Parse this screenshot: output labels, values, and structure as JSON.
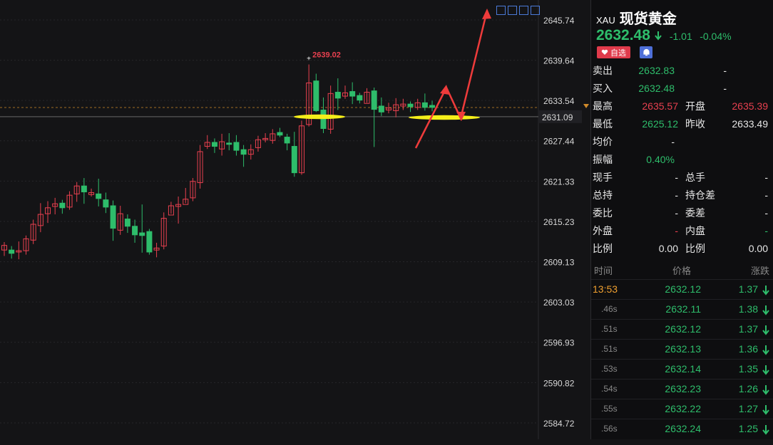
{
  "chart_data": {
    "type": "candlestick",
    "symbol": "XAU",
    "yaxis_ticks": [
      2645.74,
      2639.64,
      2633.54,
      2627.44,
      2621.33,
      2615.23,
      2609.13,
      2603.03,
      2596.93,
      2590.82,
      2584.72
    ],
    "ylim": [
      2584.0,
      2648.0
    ],
    "current_price_tag": "2631.09",
    "max_label": "2639.02",
    "candles": [
      [
        2610.9,
        2611.6,
        2610.0,
        2612.1
      ],
      [
        2610.9,
        2610.4,
        2609.6,
        2611.5
      ],
      [
        2610.6,
        2610.8,
        2609.5,
        2612.2
      ],
      [
        2610.8,
        2612.6,
        2610.2,
        2613.1
      ],
      [
        2612.4,
        2614.8,
        2611.8,
        2615.5
      ],
      [
        2614.6,
        2616.3,
        2613.6,
        2618.0
      ],
      [
        2616.4,
        2617.3,
        2615.0,
        2618.3
      ],
      [
        2617.5,
        2617.9,
        2616.3,
        2618.8
      ],
      [
        2618.0,
        2617.3,
        2616.4,
        2618.5
      ],
      [
        2617.4,
        2619.2,
        2617.0,
        2619.8
      ],
      [
        2619.4,
        2620.6,
        2618.2,
        2621.2
      ],
      [
        2620.6,
        2619.7,
        2617.9,
        2621.8
      ],
      [
        2619.3,
        2619.6,
        2619.0,
        2620.2
      ],
      [
        2619.4,
        2618.7,
        2617.5,
        2621.7
      ],
      [
        2618.5,
        2617.4,
        2616.5,
        2619.6
      ],
      [
        2617.6,
        2614.2,
        2612.3,
        2618.4
      ],
      [
        2613.9,
        2616.4,
        2613.2,
        2617.6
      ],
      [
        2615.6,
        2614.5,
        2613.5,
        2616.3
      ],
      [
        2614.5,
        2613.2,
        2612.0,
        2615.5
      ],
      [
        2613.5,
        2613.1,
        2610.5,
        2617.8
      ],
      [
        2613.7,
        2610.6,
        2610.2,
        2614.1
      ],
      [
        2610.9,
        2611.2,
        2609.8,
        2612.0
      ],
      [
        2611.5,
        2615.7,
        2611.0,
        2616.6
      ],
      [
        2616.2,
        2617.6,
        2616.4,
        2618.2
      ],
      [
        2617.5,
        2617.8,
        2614.9,
        2619.0
      ],
      [
        2617.8,
        2618.6,
        2618.0,
        2620.3
      ],
      [
        2618.8,
        2621.3,
        2618.3,
        2621.8
      ],
      [
        2621.1,
        2625.8,
        2620.2,
        2626.8
      ],
      [
        2626.6,
        2627.2,
        2626.2,
        2628.3
      ],
      [
        2627.2,
        2626.6,
        2625.6,
        2627.8
      ],
      [
        2626.2,
        2627.3,
        2625.2,
        2628.5
      ],
      [
        2627.1,
        2626.9,
        2626.0,
        2628.6
      ],
      [
        2627.2,
        2626.0,
        2625.2,
        2628.3
      ],
      [
        2626.1,
        2625.4,
        2623.5,
        2626.8
      ],
      [
        2625.4,
        2626.1,
        2624.6,
        2626.9
      ],
      [
        2626.4,
        2627.6,
        2625.8,
        2628.2
      ],
      [
        2627.6,
        2627.8,
        2627.2,
        2628.6
      ],
      [
        2627.5,
        2628.5,
        2627.0,
        2629.2
      ],
      [
        2628.7,
        2628.3,
        2628.0,
        2629.4
      ],
      [
        2628.0,
        2627.1,
        2626.0,
        2628.5
      ],
      [
        2626.6,
        2622.6,
        2622.0,
        2628.8
      ],
      [
        2622.6,
        2629.7,
        2622.3,
        2630.5
      ],
      [
        2629.9,
        2636.2,
        2629.6,
        2639.0
      ],
      [
        2636.5,
        2632.0,
        2631.8,
        2637.6
      ],
      [
        2632.1,
        2629.3,
        2628.6,
        2634.0
      ],
      [
        2629.2,
        2634.6,
        2628.5,
        2635.8
      ],
      [
        2634.8,
        2633.9,
        2632.1,
        2636.9
      ],
      [
        2634.2,
        2634.7,
        2633.8,
        2635.8
      ],
      [
        2634.9,
        2634.2,
        2633.0,
        2636.3
      ],
      [
        2634.3,
        2633.6,
        2633.1,
        2634.7
      ],
      [
        2633.1,
        2634.8,
        2633.2,
        2635.4
      ],
      [
        2635.0,
        2632.2,
        2626.5,
        2635.5
      ],
      [
        2632.7,
        2631.8,
        2631.2,
        2634.0
      ],
      [
        2632.1,
        2632.4,
        2631.6,
        2633.2
      ],
      [
        2632.0,
        2632.9,
        2631.0,
        2633.9
      ],
      [
        2632.7,
        2633.0,
        2632.1,
        2633.8
      ],
      [
        2633.0,
        2632.6,
        2631.8,
        2633.4
      ],
      [
        2632.5,
        2633.2,
        2632.1,
        2633.8
      ],
      [
        2633.2,
        2632.5,
        2632.0,
        2634.6
      ],
      [
        2632.8,
        2632.5,
        2631.9,
        2633.5
      ]
    ]
  },
  "panel": {
    "symbol": "XAU",
    "name": "现货黄金",
    "last": "2632.48",
    "change": "-1.01",
    "change_pct": "-0.04%",
    "fav_label": "自选",
    "quotes": [
      {
        "l1": "卖出",
        "v1": "2632.83",
        "c1": "dn",
        "l2": "",
        "v2": "-",
        "c2": "wh"
      },
      {
        "l1": "买入",
        "v1": "2632.48",
        "c1": "dn",
        "l2": "",
        "v2": "-",
        "c2": "wh"
      },
      {
        "l1": "最高",
        "v1": "2635.57",
        "c1": "up",
        "l2": "开盘",
        "v2": "2635.39",
        "c2": "up"
      },
      {
        "l1": "最低",
        "v1": "2625.12",
        "c1": "dn",
        "l2": "昨收",
        "v2": "2633.49",
        "c2": "wh"
      },
      {
        "l1": "均价",
        "v1": "-",
        "c1": "wh",
        "l2": "",
        "v2": "",
        "c2": "wh"
      },
      {
        "l1": "振幅",
        "v1": "0.40%",
        "c1": "dn",
        "l2": "",
        "v2": "",
        "c2": "wh"
      },
      {
        "l1": "现手",
        "v1": "-",
        "c1": "wh",
        "l2": "总手",
        "v2": "-",
        "c2": "wh"
      },
      {
        "l1": "总持",
        "v1": "-",
        "c1": "wh",
        "l2": "持仓差",
        "v2": "-",
        "c2": "wh"
      },
      {
        "l1": "委比",
        "v1": "-",
        "c1": "wh",
        "l2": "委差",
        "v2": "-",
        "c2": "wh"
      },
      {
        "l1": "外盘",
        "v1": "-",
        "c1": "up",
        "l2": "内盘",
        "v2": "-",
        "c2": "dn"
      },
      {
        "l1": "比例",
        "v1": "0.00",
        "c1": "wh",
        "l2": "比例",
        "v2": "0.00",
        "c2": "wh"
      }
    ],
    "tick_headers": {
      "time": "时间",
      "price": "价格",
      "change": "涨跌"
    },
    "ticks": [
      {
        "t": "13:53",
        "p": "2632.12",
        "c": "1.37"
      },
      {
        "t": ".46s",
        "p": "2632.11",
        "c": "1.38"
      },
      {
        "t": ".51s",
        "p": "2632.12",
        "c": "1.37"
      },
      {
        "t": ".51s",
        "p": "2632.13",
        "c": "1.36"
      },
      {
        "t": ".53s",
        "p": "2632.14",
        "c": "1.35"
      },
      {
        "t": ".54s",
        "p": "2632.23",
        "c": "1.26"
      },
      {
        "t": ".55s",
        "p": "2632.22",
        "c": "1.27"
      },
      {
        "t": ".56s",
        "p": "2632.24",
        "c": "1.25"
      }
    ]
  },
  "colors": {
    "up": "#e8404f",
    "down": "#2ebd6b",
    "highlight": "#f5ee1a",
    "arrow": "#ef3b3b",
    "bg": "#141416"
  }
}
